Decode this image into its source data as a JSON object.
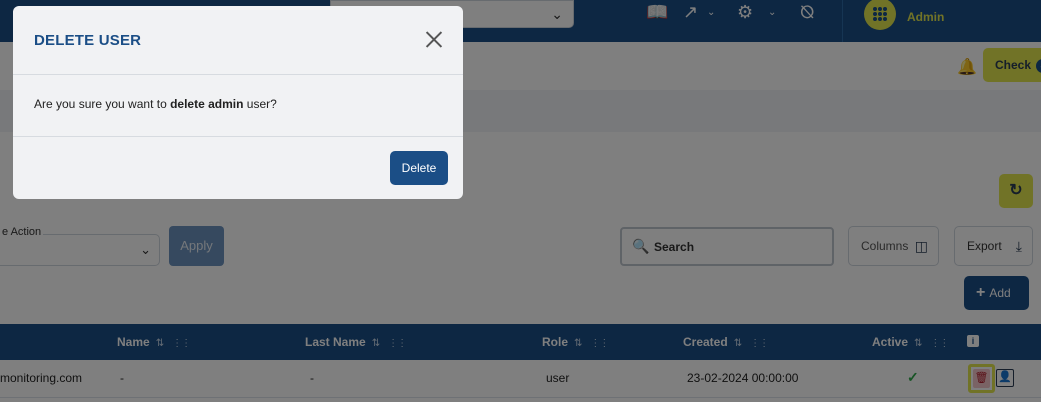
{
  "header": {
    "admin_name": "Admin",
    "icons": [
      "book-icon",
      "external-link-icon",
      "settings-gears-icon",
      "no-fingerprint-icon"
    ]
  },
  "subbar": {
    "check_label": "Check"
  },
  "toolbar": {
    "bulk_action_label": "e Action",
    "apply_label": "Apply",
    "search_placeholder": "Search",
    "columns_label": "Columns",
    "export_label": "Export",
    "add_label": "Add"
  },
  "table": {
    "columns": [
      {
        "label": "Name"
      },
      {
        "label": "Last Name"
      },
      {
        "label": "Role"
      },
      {
        "label": "Created"
      },
      {
        "label": "Active"
      }
    ],
    "rows": [
      {
        "email": "monitoring.com",
        "name": "-",
        "last_name": "-",
        "role": "user",
        "created": "23-02-2024 00:00:00",
        "active": true
      }
    ]
  },
  "modal": {
    "title": "DELETE USER",
    "body_prefix": "Are you sure you want to ",
    "body_bold": "delete admin",
    "body_suffix": " user?",
    "delete_label": "Delete"
  },
  "colors": {
    "primary": "#1b4e86",
    "accent": "#e3e64e",
    "success": "#2ea84a",
    "danger": "#b3202e"
  }
}
